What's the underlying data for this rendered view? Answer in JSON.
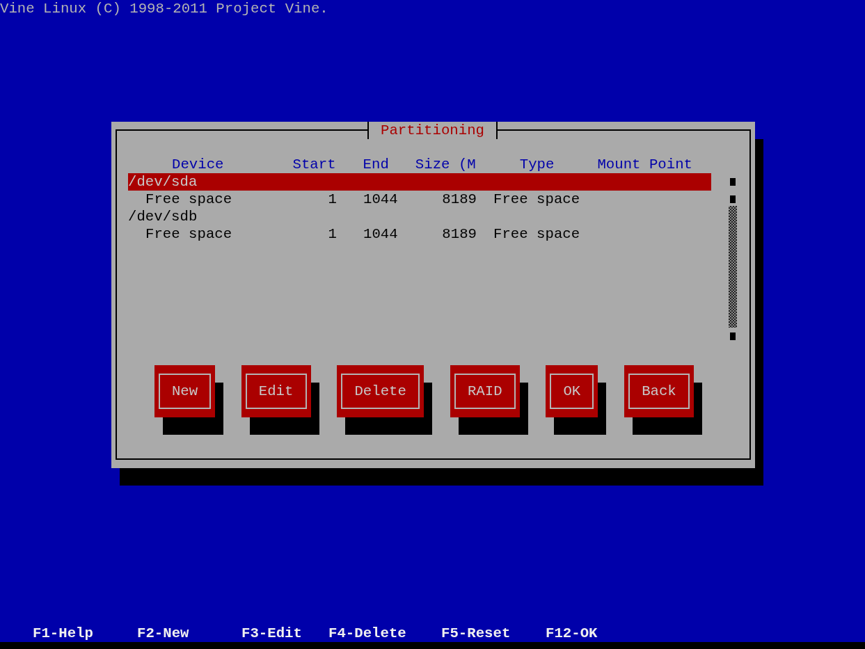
{
  "header": {
    "text": "Vine Linux (C) 1998-2011 Project Vine."
  },
  "dialog": {
    "title": "Partitioning",
    "columns": [
      "Device",
      "Start",
      "End",
      "Size (M",
      "Type",
      "Mount Point"
    ],
    "rows": [
      {
        "device": "/dev/sda",
        "selected": true,
        "children": [
          {
            "device": "Free space",
            "start": "1",
            "end": "1044",
            "size": "8189",
            "type": "Free space",
            "selected": false
          }
        ]
      },
      {
        "device": "/dev/sdb",
        "selected": false,
        "children": [
          {
            "device": "Free space",
            "start": "1",
            "end": "1044",
            "size": "8189",
            "type": "Free space",
            "selected": false
          }
        ]
      }
    ],
    "buttons": [
      "New",
      "Edit",
      "Delete",
      "RAID",
      "OK",
      "Back"
    ]
  },
  "footer": [
    "F1-Help",
    "F2-New",
    "F3-Edit",
    "F4-Delete",
    "F5-Reset",
    "F12-OK"
  ]
}
